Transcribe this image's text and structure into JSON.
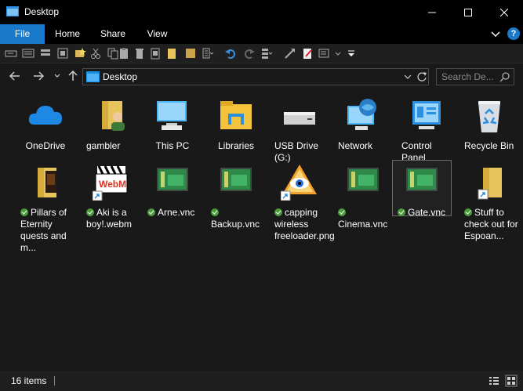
{
  "window": {
    "title": "Desktop",
    "minimize_icon": "minimize-icon",
    "maximize_icon": "maximize-icon",
    "close_icon": "close-icon"
  },
  "ribbon": {
    "tabs": [
      {
        "label": "File"
      },
      {
        "label": "Home"
      },
      {
        "label": "Share"
      },
      {
        "label": "View"
      }
    ],
    "help_label": "?"
  },
  "address": {
    "path": "Desktop",
    "search_placeholder": "Search De..."
  },
  "items": [
    {
      "name": "OneDrive",
      "synced": false
    },
    {
      "name": "gambler",
      "synced": false
    },
    {
      "name": "This PC",
      "synced": false
    },
    {
      "name": "Libraries",
      "synced": false
    },
    {
      "name": "USB Drive (G:)",
      "synced": false
    },
    {
      "name": "Network",
      "synced": false
    },
    {
      "name": "Control Panel",
      "synced": false
    },
    {
      "name": "Recycle Bin",
      "synced": false
    },
    {
      "name": "Pillars of Eternity quests and m...",
      "synced": true
    },
    {
      "name": "Aki is a boy!.webm",
      "synced": true
    },
    {
      "name": "Arne.vnc",
      "synced": true
    },
    {
      "name": "Backup.vnc",
      "synced": true
    },
    {
      "name": "capping wireless freeloader.png",
      "synced": true
    },
    {
      "name": "Cinema.vnc",
      "synced": true
    },
    {
      "name": "Gate.vnc",
      "synced": true,
      "selected": true
    },
    {
      "name": "Stuff to check out for Espoan...",
      "synced": true
    }
  ],
  "status": {
    "item_count": "16 items"
  },
  "colors": {
    "accent": "#1979ca",
    "background": "#191919",
    "titlebar": "#000000",
    "sync_green": "#4a9c3b"
  }
}
